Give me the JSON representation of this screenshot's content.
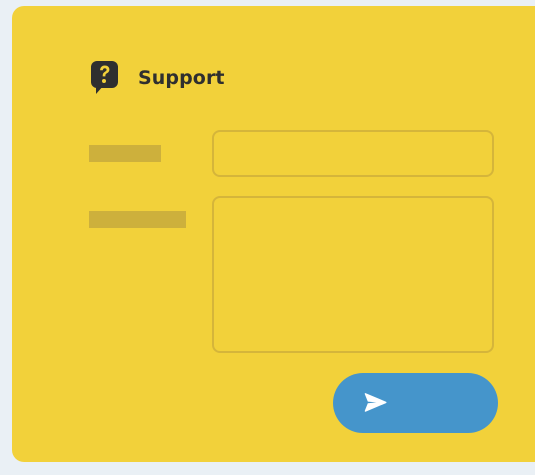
{
  "header": {
    "title": "Support",
    "icon": "question-chat-icon"
  },
  "form": {
    "field_1": {
      "label": "",
      "value": "",
      "placeholder": ""
    },
    "field_2": {
      "label": "",
      "value": "",
      "placeholder": ""
    }
  },
  "actions": {
    "send_icon": "send-icon"
  },
  "colors": {
    "card": "#f2d13a",
    "send_button": "#4595cb",
    "background": "#eaf0f5"
  }
}
